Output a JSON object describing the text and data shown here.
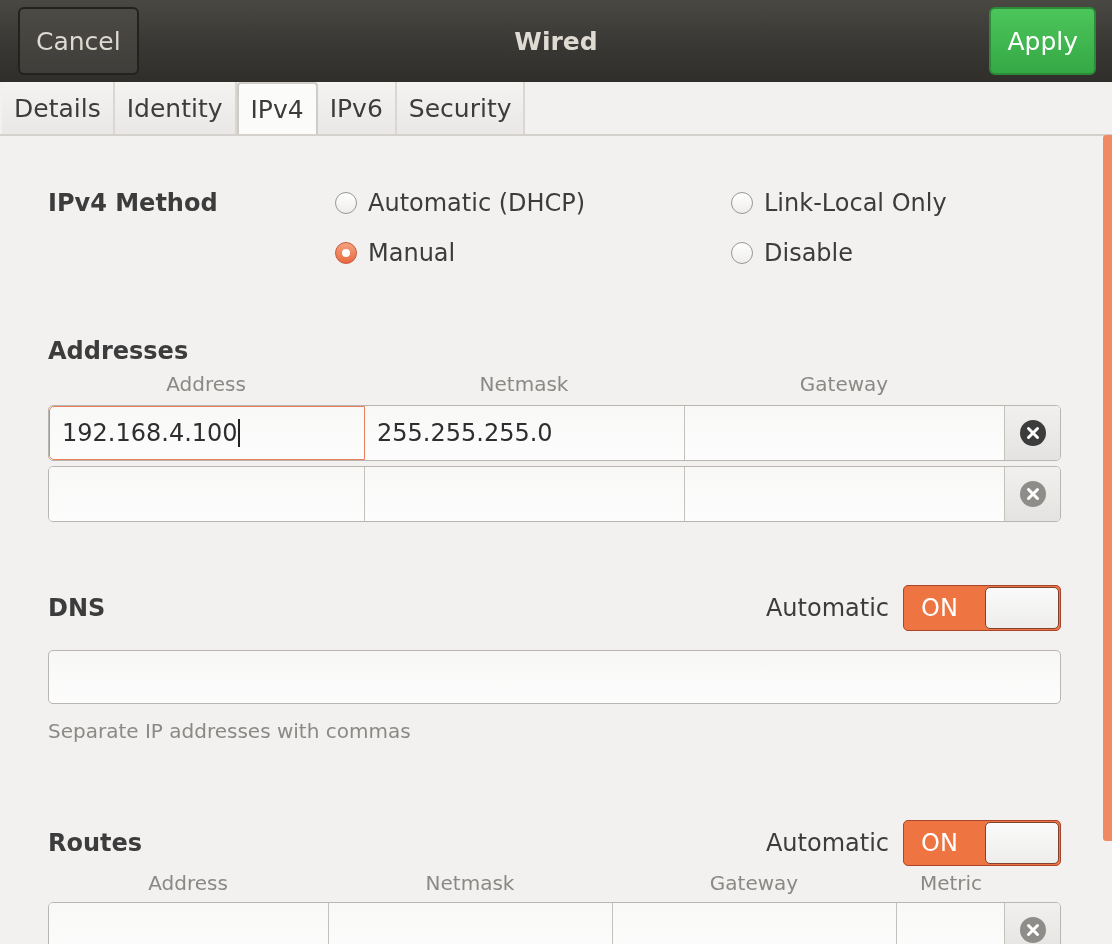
{
  "window": {
    "title": "Wired"
  },
  "header_buttons": [
    {
      "label": "Cancel",
      "kind": "cancel"
    },
    {
      "label": "Apply",
      "kind": "apply"
    }
  ],
  "tabs": [
    {
      "label": "Details",
      "selected": false
    },
    {
      "label": "Identity",
      "selected": false
    },
    {
      "label": "IPv4",
      "selected": true
    },
    {
      "label": "IPv6",
      "selected": false
    },
    {
      "label": "Security",
      "selected": false
    }
  ],
  "ipv4_method": {
    "label": "IPv4 Method",
    "options": [
      {
        "label": "Automatic (DHCP)",
        "selected": false
      },
      {
        "label": "Link-Local Only",
        "selected": false
      },
      {
        "label": "Manual",
        "selected": true
      },
      {
        "label": "Disable",
        "selected": false
      }
    ]
  },
  "addresses": {
    "title": "Addresses",
    "columns": [
      "Address",
      "Netmask",
      "Gateway"
    ],
    "rows": [
      {
        "address": "192.168.4.100",
        "netmask": "255.255.255.0",
        "focused": true,
        "removable": true
      },
      {
        "focused": false,
        "removable": false
      }
    ]
  },
  "dns": {
    "title": "DNS",
    "automatic_label": "Automatic",
    "switch_text": "ON",
    "on": true,
    "hint": "Separate IP addresses with commas"
  },
  "routes": {
    "title": "Routes",
    "automatic_label": "Automatic",
    "switch_text": "ON",
    "on": true,
    "columns": [
      "Address",
      "Netmask",
      "Gateway",
      "Metric"
    ],
    "rows": [
      {
        "removable": false
      }
    ]
  }
}
